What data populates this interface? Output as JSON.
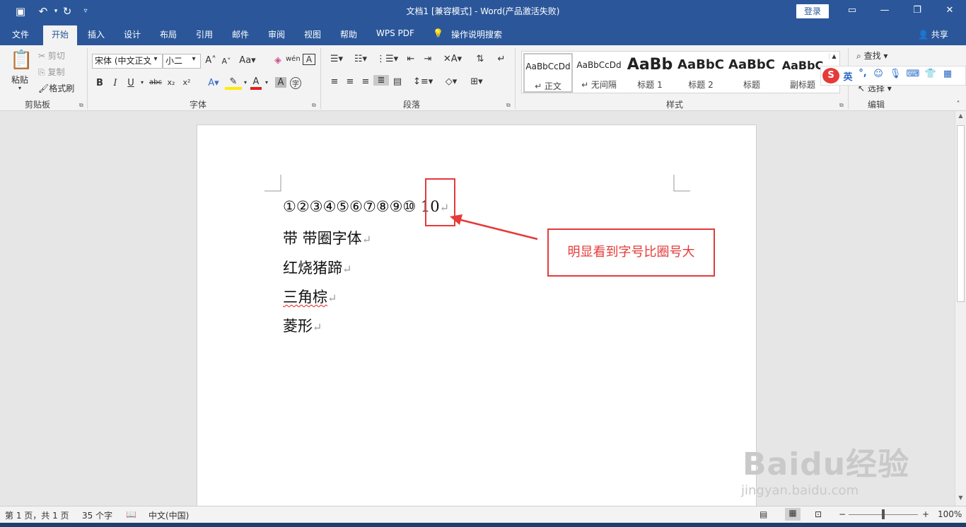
{
  "titlebar": {
    "title": "文档1 [兼容模式] - Word(产品激活失败)",
    "login": "登录"
  },
  "tabs": [
    "文件",
    "开始",
    "插入",
    "设计",
    "布局",
    "引用",
    "邮件",
    "审阅",
    "视图",
    "帮助",
    "WPS PDF",
    "操作说明搜索"
  ],
  "active_tab": "开始",
  "share": "共享",
  "clipboard": {
    "paste": "粘贴",
    "cut": "剪切",
    "copy": "复制",
    "format_painter": "格式刷",
    "label": "剪贴板"
  },
  "font": {
    "name": "宋体 (中文正文",
    "size": "小二",
    "label": "字体",
    "change_case": "Aa",
    "clear_format": "A"
  },
  "paragraph": {
    "label": "段落"
  },
  "styles": {
    "label": "样式",
    "items": [
      {
        "preview": "AaBbCcDd",
        "name": "↵ 正文"
      },
      {
        "preview": "AaBbCcDd",
        "name": "↵ 无间隔"
      },
      {
        "preview": "AaBb",
        "name": "标题 1"
      },
      {
        "preview": "AaBbC",
        "name": "标题 2"
      },
      {
        "preview": "AaBbC",
        "name": "标题"
      },
      {
        "preview": "AaBbC",
        "name": "副标题"
      }
    ]
  },
  "editing": {
    "find": "查找",
    "select": "选择",
    "label": "编辑"
  },
  "ime": {
    "lang": "英"
  },
  "document": {
    "lines": [
      "①②③④⑤⑥⑦⑧⑨⑩  10",
      "带  带圈字体",
      "红烧猪蹄",
      "三角棕",
      "菱形"
    ]
  },
  "annotation": {
    "callout": "明显看到字号比圈号大"
  },
  "watermark": {
    "brand": "Baidu经验",
    "url": "jingyan.baidu.com"
  },
  "status": {
    "page": "第 1 页，共 1 页",
    "words": "35 个字",
    "language": "中文(中国)",
    "zoom": "100%"
  },
  "colors": {
    "accent": "#2b579a",
    "annotation": "#e53a3a"
  }
}
